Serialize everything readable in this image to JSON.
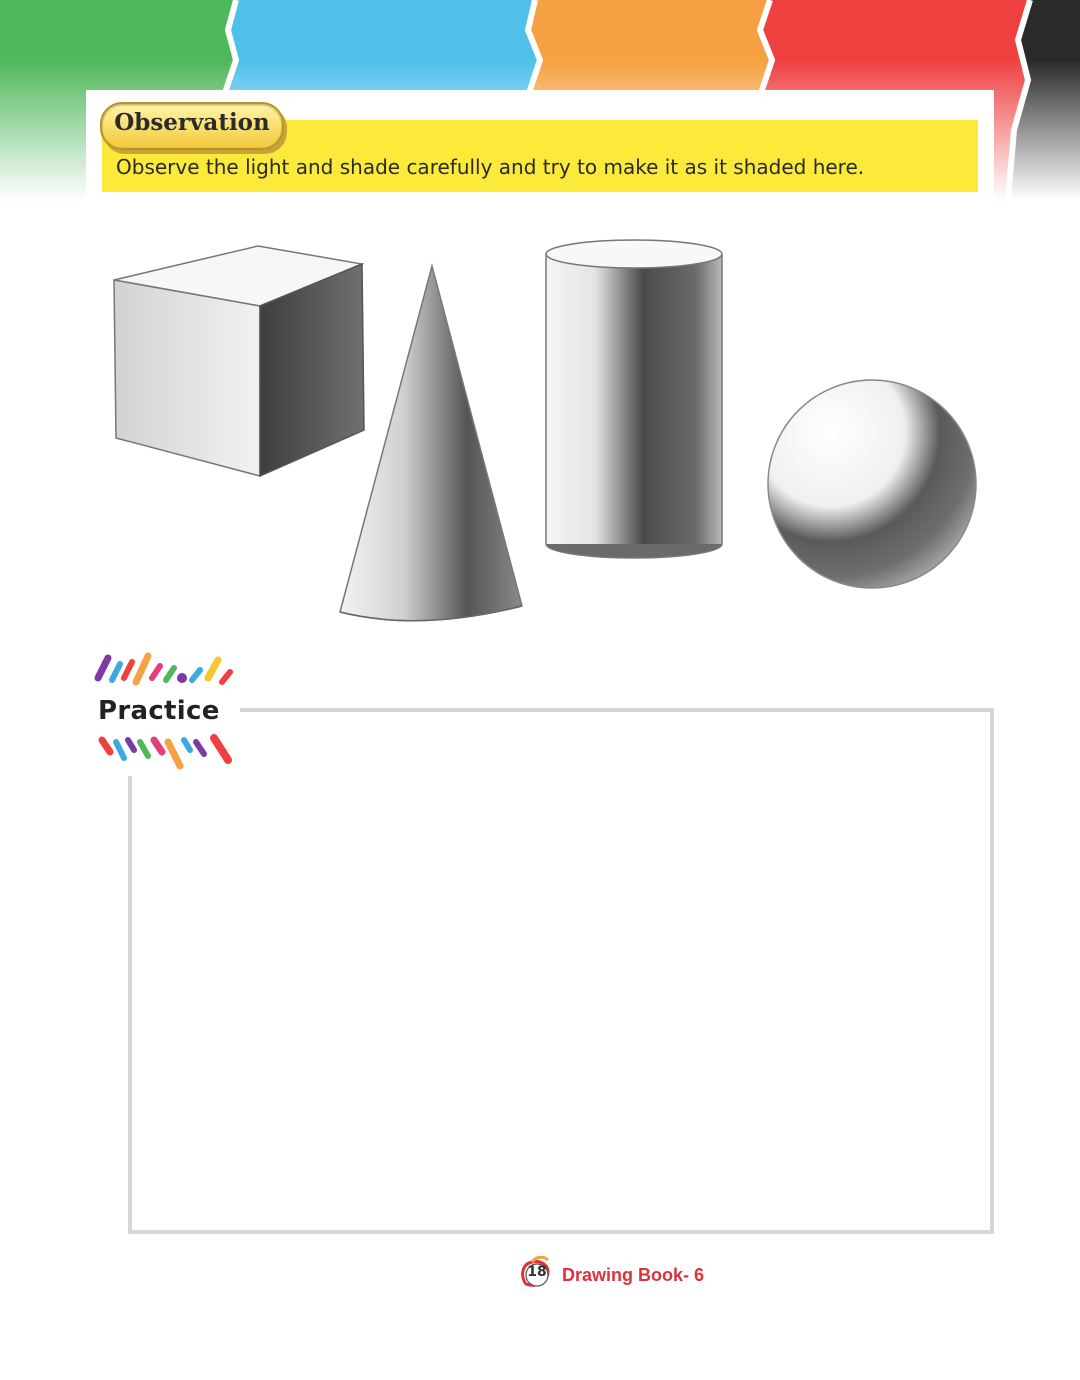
{
  "observation": {
    "badge": "Observation",
    "instruction": "Observe the light and shade carefully and try to make it as it shaded here."
  },
  "practice": {
    "label": "Practice"
  },
  "footer": {
    "page_number": "18",
    "book_title": "Drawing Book- 6"
  },
  "icons": {
    "shapes": [
      "cube",
      "cone",
      "cylinder",
      "sphere"
    ]
  },
  "colors": {
    "banner": [
      "#4fb85a",
      "#4fc0ea",
      "#f6a244",
      "#ef4040",
      "#2a2a2a"
    ],
    "instruction_bg": "#fbea3a",
    "footer_title": "#e0303a"
  }
}
